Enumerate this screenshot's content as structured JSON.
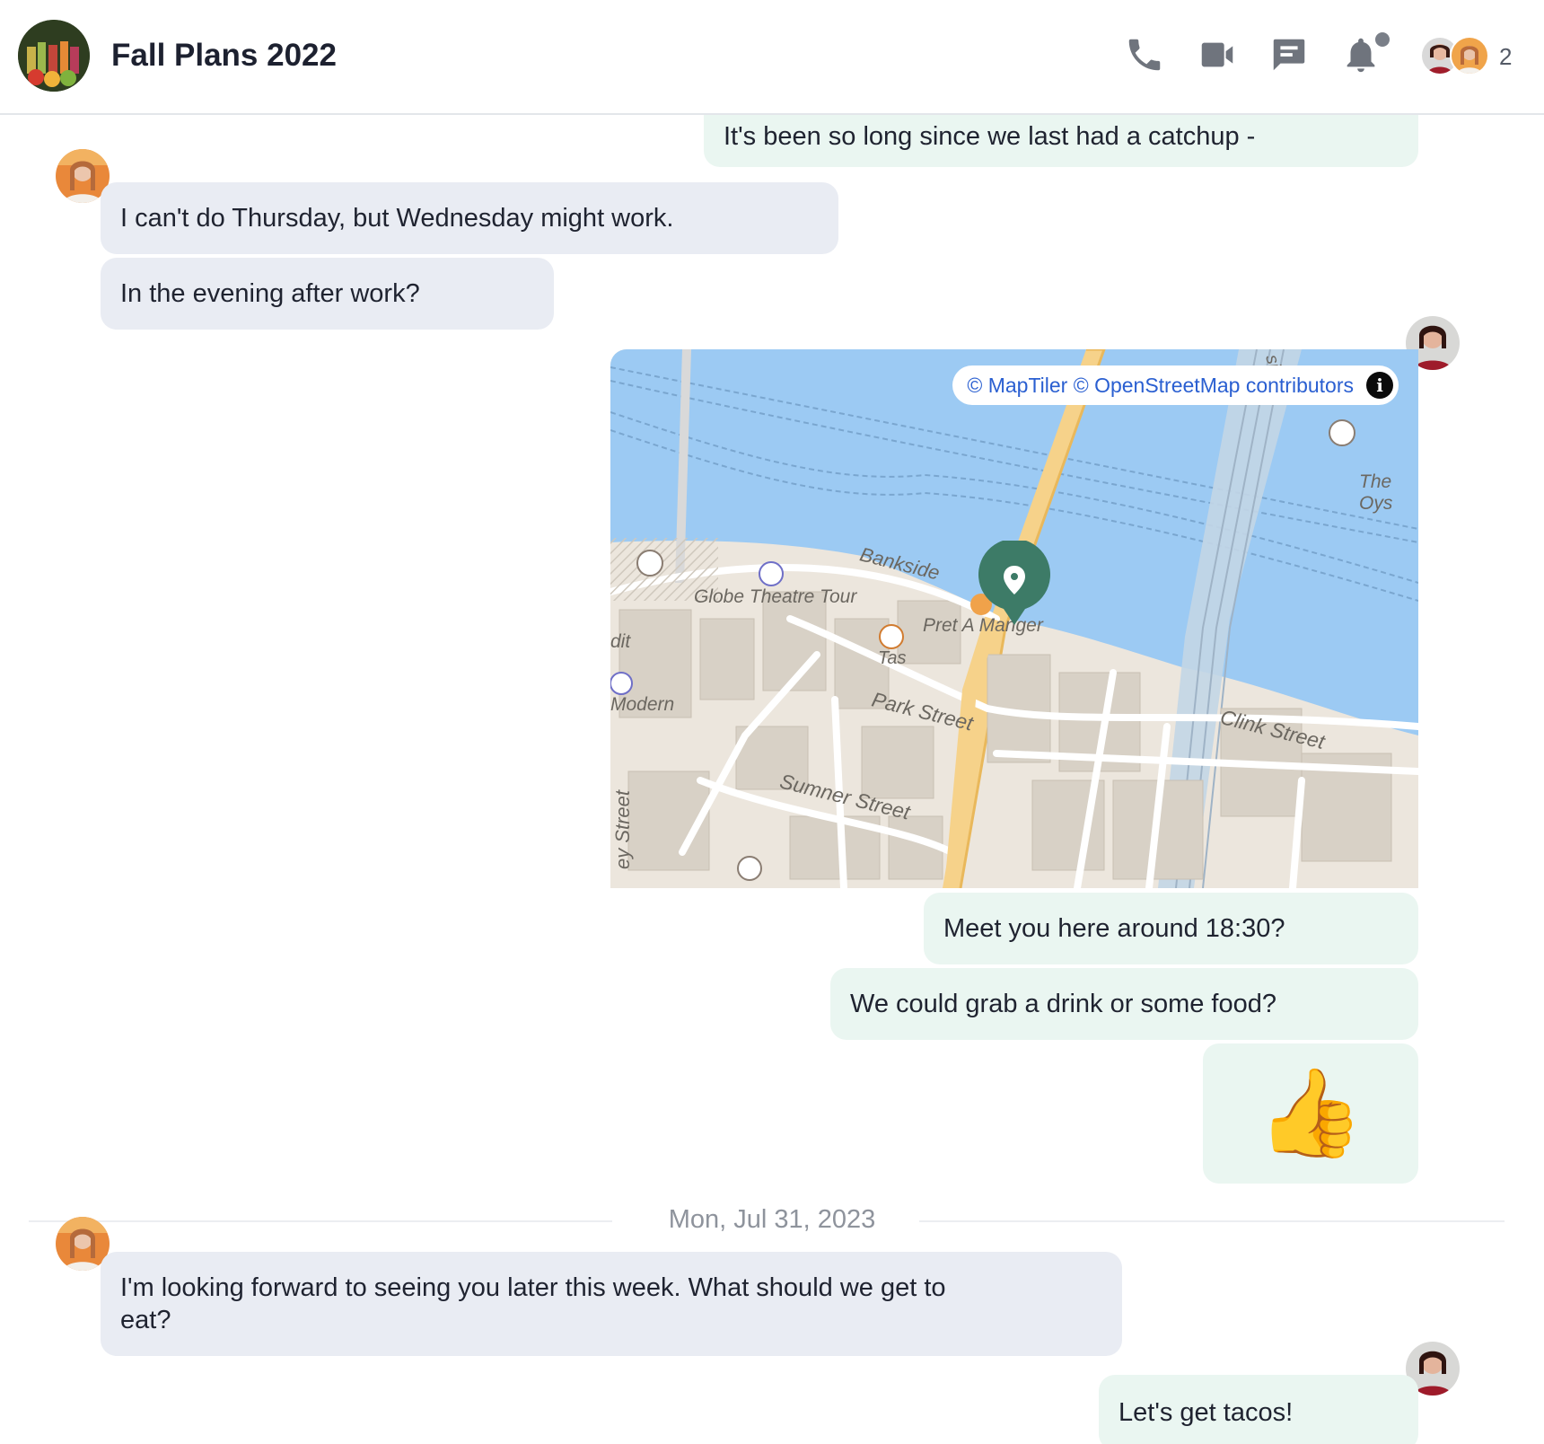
{
  "header": {
    "title": "Fall Plans 2022",
    "member_count": "2"
  },
  "messages": {
    "m0": "It's been so long since we last had a catchup -",
    "m1": "I can't do Thursday, but Wednesday might work.",
    "m2": "In the evening after work?",
    "m3": "Meet you here around 18:30?",
    "m4": "We could grab a drink or some food?",
    "m5": "👍",
    "m6": "I'm looking forward to seeing you later this week. What should we get to eat?",
    "m7": "Let's get tacos!"
  },
  "date_separator": "Mon, Jul 31, 2023",
  "map": {
    "attribution": "© MapTiler © OpenStreetMap contributors",
    "info_glyph": "i",
    "labels": {
      "bankside": "Bankside",
      "globe": "Globe Theatre Tour",
      "pret": "Pret A Manger",
      "tas": "Tas",
      "park": "Park Street",
      "clink": "Clink Street",
      "sumner": "Sumner Street",
      "modern": "Modern",
      "dit": "dit",
      "ey_street": "ey Street",
      "oys": "The Oys",
      "si": "si"
    }
  },
  "colors": {
    "incoming_bubble": "#e9ecf3",
    "outgoing_bubble": "#eaf6f1",
    "water": "#9ccaf3",
    "land": "#ece6dd",
    "pin": "#3d7b67",
    "link": "#2a5fd1"
  },
  "icons": [
    "phone-icon",
    "video-icon",
    "chat-icon",
    "bell-icon",
    "pin-icon",
    "info-icon"
  ]
}
